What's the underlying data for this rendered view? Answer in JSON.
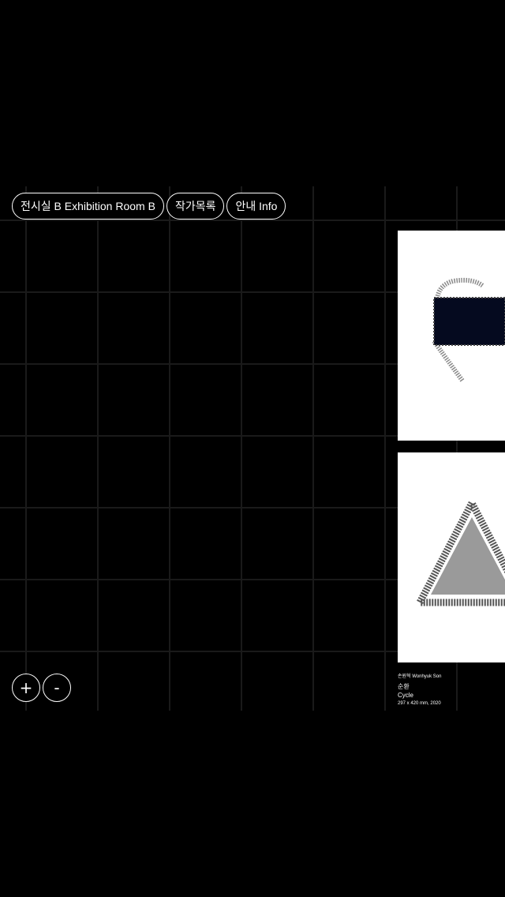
{
  "nav": {
    "exhibition_room": "전시실 B Exhibition Room B",
    "artists": "작가목록",
    "info": "안내 Info"
  },
  "zoom": {
    "zoom_in_label": "+",
    "zoom_out_label": "-"
  },
  "artworks": [
    {
      "image_icon": "dark-rectangle-with-curved-strokes-artwork",
      "colors": {
        "background": "#ffffff",
        "shape": "#050a1f"
      }
    },
    {
      "image_icon": "grey-triangle-with-serrated-outline-artwork",
      "colors": {
        "background": "#ffffff",
        "shape": "#9a9a9a",
        "outline": "#555555"
      }
    }
  ],
  "caption": {
    "artist": "손원혁 Wonhyuk Son",
    "title_ko": "순환",
    "title_en": "Cycle",
    "spec": "297 x 420 mm, 2020"
  },
  "colors": {
    "background": "#000000",
    "grid_line": "#1a1a1a",
    "text": "#ffffff"
  }
}
